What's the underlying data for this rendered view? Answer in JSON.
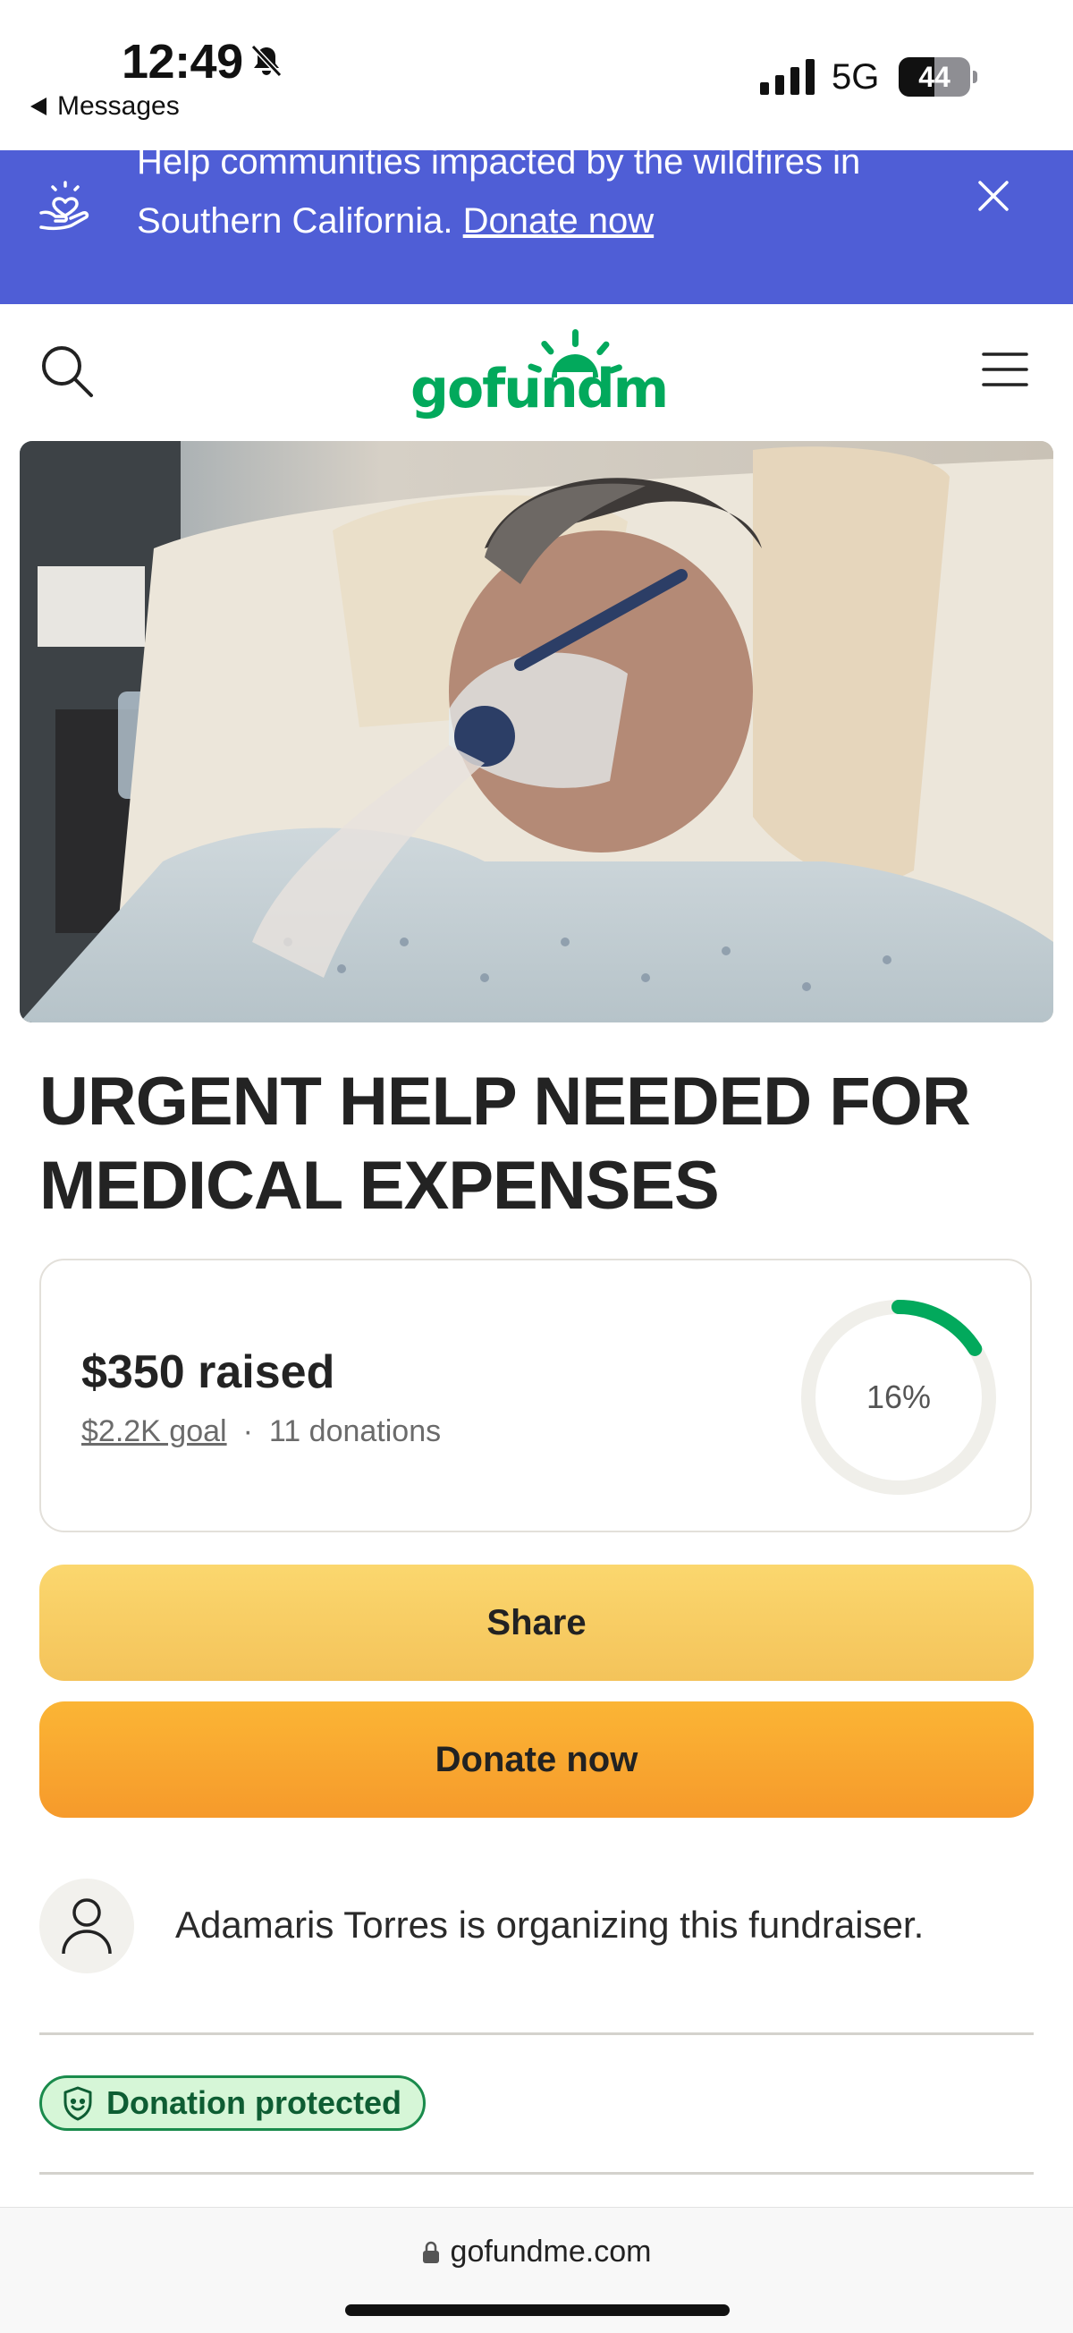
{
  "status_bar": {
    "time": "12:49",
    "back_label": "Messages",
    "network": "5G",
    "battery": "44"
  },
  "banner": {
    "text": "Help communities impacted by the wildfires in Southern California.",
    "link": "Donate now",
    "bg_color": "#4f5ed6"
  },
  "header": {
    "logo_text": "gofundme",
    "brand_color": "#02a95c"
  },
  "campaign": {
    "title": "URGENT HELP NEEDED FOR MEDICAL EXPENSES",
    "raised": "$350 raised",
    "goal": "$2.2K goal",
    "separator": "·",
    "donations": "11 donations",
    "progress_label": "16%",
    "progress_fraction": 0.16
  },
  "buttons": {
    "share": "Share",
    "donate": "Donate now"
  },
  "organizer": {
    "text": "Adamaris Torres is organizing this fundraiser."
  },
  "badge": {
    "text": "Donation protected"
  },
  "browser": {
    "url": "gofundme.com"
  }
}
